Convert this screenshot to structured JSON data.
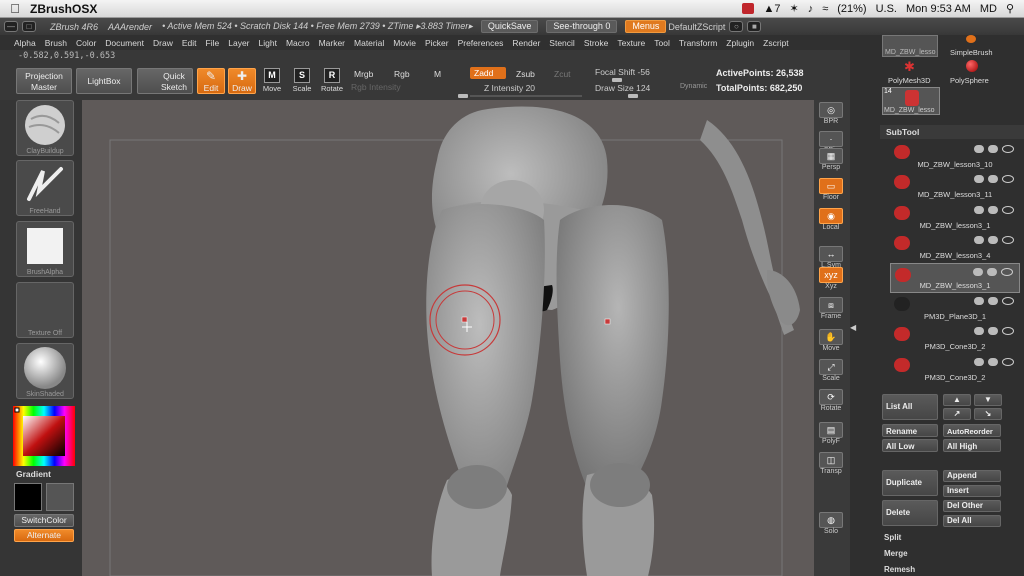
{
  "mac_menubar": {
    "app_name": "ZBrushOSX",
    "status": {
      "battery": "(21%)",
      "input": "U.S.",
      "clock": "Mon 9:53 AM",
      "user": "MD",
      "notify_count": "7"
    }
  },
  "title_bar": {
    "app": "ZBrush 4R6",
    "render": "AAArender",
    "stats": "• Active Mem 524 • Scratch Disk 144 • Free Mem 2739 • ZTime ▸3.883 Timer▸",
    "quicksave": "QuickSave",
    "seethrough": "See-through  0",
    "menus": "Menus",
    "default_zscript": "DefaultZScript"
  },
  "menu_items": [
    "Alpha",
    "Brush",
    "Color",
    "Document",
    "Draw",
    "Edit",
    "File",
    "Layer",
    "Light",
    "Macro",
    "Marker",
    "Material",
    "Movie",
    "Picker",
    "Preferences",
    "Render",
    "Stencil",
    "Stroke",
    "Texture",
    "Tool",
    "Transform",
    "Zplugin",
    "Zscript"
  ],
  "coords": "-0.582,0.591,-0.653",
  "shelf": {
    "projection_master": "Projection Master",
    "lightbox": "LightBox",
    "quick_sketch": "Quick Sketch",
    "edit": "Edit",
    "draw": "Draw",
    "move": "Move",
    "scale": "Scale",
    "rotate": "Rotate",
    "mrgb": "Mrgb",
    "rgb": "Rgb",
    "m": "M",
    "zadd": "Zadd",
    "zsub": "Zsub",
    "zcut": "Zcut",
    "rgb_intensity": "Rgb Intensity",
    "z_intensity": "Z Intensity 20",
    "focal_shift": "Focal Shift -56",
    "draw_size": "Draw Size 124",
    "dynamic": "Dynamic",
    "active_points": "ActivePoints: 26,538",
    "total_points": "TotalPoints: 682,250"
  },
  "left_tray": {
    "brush": "ClayBuildup",
    "stroke": "FreeHand",
    "alpha": "BrushAlpha",
    "texture": "Texture Off",
    "material": "SkinShaded",
    "gradient": "Gradient",
    "switch_color": "SwitchColor",
    "alternate": "Alternate"
  },
  "right_shelf": [
    "BPR",
    "SPix",
    "Persp",
    "Floor",
    "Local",
    "L.Sym",
    "Xyz",
    "Frame",
    "Move",
    "Scale",
    "Rotate",
    "PolyF",
    "Transp",
    "Solo"
  ],
  "tool_palette": {
    "thumbs": [
      "MD_ZBW_lesso",
      "SimpleBrush",
      "PolyMesh3D",
      "PolySphere",
      "MD_ZBW_lesso"
    ],
    "thumb_count": "14",
    "subtool_title": "SubTool",
    "subtools": [
      "MD_ZBW_lesson3_10",
      "MD_ZBW_lesson3_11",
      "MD_ZBW_lesson3_1",
      "MD_ZBW_lesson3_4",
      "MD_ZBW_lesson3_1",
      "PM3D_Plane3D_1",
      "PM3D_Cone3D_2",
      "PM3D_Cone3D_2"
    ],
    "active_index": 4,
    "list_all": "List All",
    "rename": "Rename",
    "autoreorder": "AutoReorder",
    "all_low": "All Low",
    "all_high": "All High",
    "duplicate": "Duplicate",
    "append": "Append",
    "insert": "Insert",
    "delete": "Delete",
    "del_other": "Del Other",
    "del_all": "Del All",
    "split": "Split",
    "merge": "Merge",
    "remesh": "Remesh"
  },
  "colors": {
    "accent": "#e0701a",
    "canvas": "#5f5a59",
    "panel": "#383838"
  }
}
